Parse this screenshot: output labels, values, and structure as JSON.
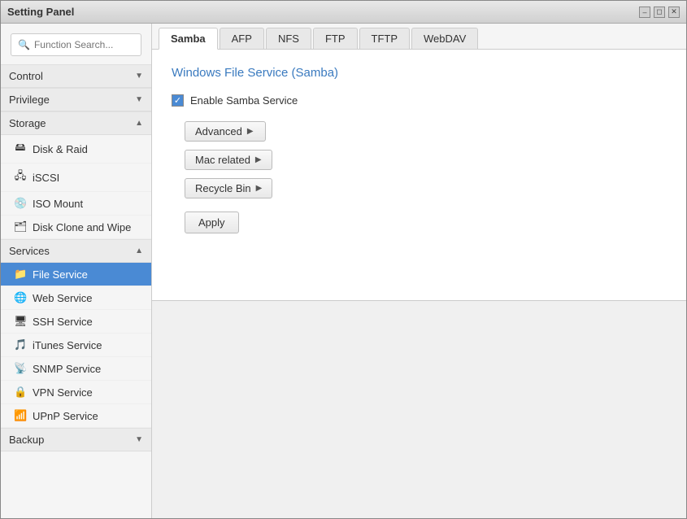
{
  "window": {
    "title": "Setting Panel",
    "controls": {
      "minimize": "–",
      "restore": "◻",
      "close": "✕"
    }
  },
  "sidebar": {
    "search_placeholder": "Function Search...",
    "sections": [
      {
        "id": "control",
        "label": "Control",
        "expanded": true,
        "items": []
      },
      {
        "id": "privilege",
        "label": "Privilege",
        "expanded": true,
        "items": []
      },
      {
        "id": "storage",
        "label": "Storage",
        "expanded": true,
        "items": [
          {
            "id": "disk-raid",
            "label": "Disk & Raid",
            "icon": "🖴"
          },
          {
            "id": "iscsi",
            "label": "iSCSI",
            "icon": "🖧"
          },
          {
            "id": "iso-mount",
            "label": "ISO Mount",
            "icon": "💿"
          },
          {
            "id": "disk-clone",
            "label": "Disk Clone and Wipe",
            "icon": "🗂"
          }
        ]
      },
      {
        "id": "services",
        "label": "Services",
        "expanded": true,
        "items": [
          {
            "id": "file-service",
            "label": "File Service",
            "icon": "📁",
            "active": true
          },
          {
            "id": "web-service",
            "label": "Web Service",
            "icon": "🌐"
          },
          {
            "id": "ssh-service",
            "label": "SSH Service",
            "icon": "🖥"
          },
          {
            "id": "itunes-service",
            "label": "iTunes Service",
            "icon": "🎵"
          },
          {
            "id": "snmp-service",
            "label": "SNMP Service",
            "icon": "📡"
          },
          {
            "id": "vpn-service",
            "label": "VPN Service",
            "icon": "🔒"
          },
          {
            "id": "upnp-service",
            "label": "UPnP Service",
            "icon": "📶"
          }
        ]
      },
      {
        "id": "backup",
        "label": "Backup",
        "expanded": true,
        "items": []
      }
    ]
  },
  "content": {
    "tabs": [
      {
        "id": "samba",
        "label": "Samba",
        "active": true
      },
      {
        "id": "afp",
        "label": "AFP",
        "active": false
      },
      {
        "id": "nfs",
        "label": "NFS",
        "active": false
      },
      {
        "id": "ftp",
        "label": "FTP",
        "active": false
      },
      {
        "id": "tftp",
        "label": "TFTP",
        "active": false
      },
      {
        "id": "webdav",
        "label": "WebDAV",
        "active": false
      }
    ],
    "panel": {
      "title": "Windows File Service (Samba)",
      "enable_label": "Enable Samba Service",
      "enable_checked": true,
      "buttons": [
        {
          "id": "advanced",
          "label": "Advanced"
        },
        {
          "id": "mac-related",
          "label": "Mac related"
        },
        {
          "id": "recycle-bin",
          "label": "Recycle Bin"
        }
      ],
      "apply_label": "Apply"
    }
  }
}
